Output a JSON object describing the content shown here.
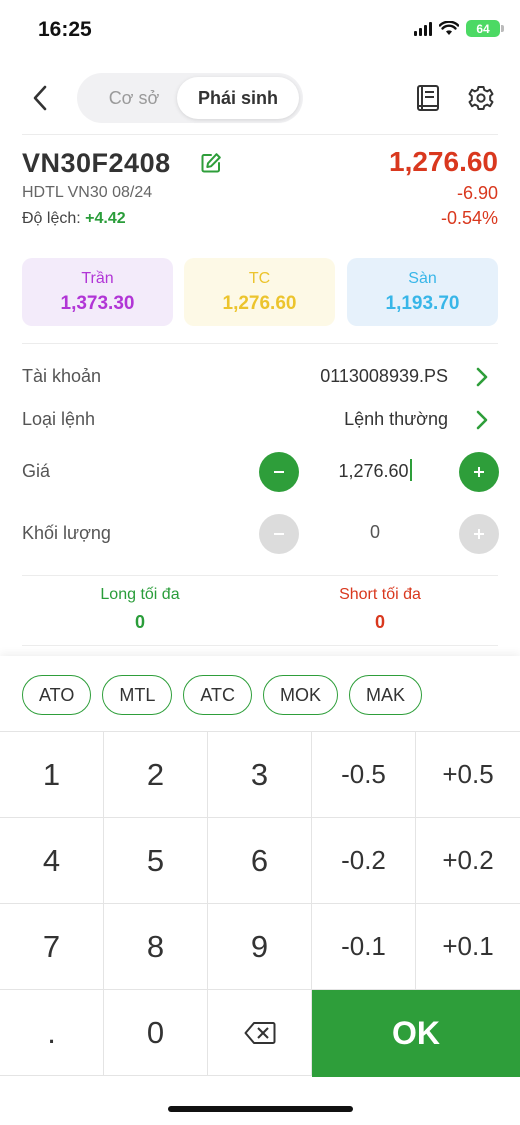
{
  "status_bar": {
    "time": "16:25",
    "battery": "64"
  },
  "nav": {
    "tab_spot": "Cơ sở",
    "tab_derivatives": "Phái sinh"
  },
  "instrument": {
    "symbol": "VN30F2408",
    "name": "HDTL VN30 08/24",
    "deviation_label": "Độ lệch:",
    "deviation_value": "+4.42",
    "price": "1,276.60",
    "change": "-6.90",
    "change_pct": "-0.54%"
  },
  "reference_prices": {
    "ceiling_label": "Trần",
    "ceiling_value": "1,373.30",
    "ref_label": "TC",
    "ref_value": "1,276.60",
    "floor_label": "Sàn",
    "floor_value": "1,193.70"
  },
  "form": {
    "account_label": "Tài khoản",
    "account_value": "0113008939.PS",
    "order_type_label": "Loại lệnh",
    "order_type_value": "Lệnh thường",
    "price_label": "Giá",
    "price_value": "1,276.60",
    "quantity_label": "Khối lượng",
    "quantity_value": "0"
  },
  "max": {
    "long_label": "Long tối đa",
    "long_value": "0",
    "short_label": "Short tối đa",
    "short_value": "0"
  },
  "order_chips": [
    "ATO",
    "MTL",
    "ATC",
    "MOK",
    "MAK"
  ],
  "keypad": {
    "rows": [
      [
        "1",
        "2",
        "3",
        "-0.5",
        "+0.5"
      ],
      [
        "4",
        "5",
        "6",
        "-0.2",
        "+0.2"
      ],
      [
        "7",
        "8",
        "9",
        "-0.1",
        "+0.1"
      ],
      [
        ".",
        "0"
      ]
    ],
    "ok_label": "OK",
    "backspace_icon": "backspace-icon"
  },
  "colors": {
    "accent_green": "#2e9e3a",
    "down_red": "#d9381e",
    "ceiling_purple": "#b135d6",
    "ref_yellow": "#ecc42d",
    "floor_blue": "#38b6e8"
  }
}
